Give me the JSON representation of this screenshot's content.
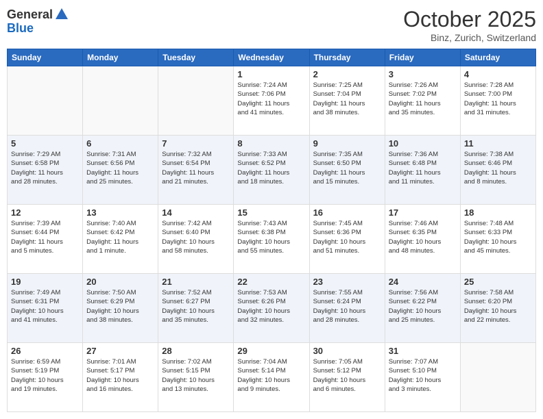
{
  "logo": {
    "general": "General",
    "blue": "Blue"
  },
  "title": "October 2025",
  "location": "Binz, Zurich, Switzerland",
  "days_of_week": [
    "Sunday",
    "Monday",
    "Tuesday",
    "Wednesday",
    "Thursday",
    "Friday",
    "Saturday"
  ],
  "weeks": [
    [
      {
        "day": "",
        "info": ""
      },
      {
        "day": "",
        "info": ""
      },
      {
        "day": "",
        "info": ""
      },
      {
        "day": "1",
        "info": "Sunrise: 7:24 AM\nSunset: 7:06 PM\nDaylight: 11 hours\nand 41 minutes."
      },
      {
        "day": "2",
        "info": "Sunrise: 7:25 AM\nSunset: 7:04 PM\nDaylight: 11 hours\nand 38 minutes."
      },
      {
        "day": "3",
        "info": "Sunrise: 7:26 AM\nSunset: 7:02 PM\nDaylight: 11 hours\nand 35 minutes."
      },
      {
        "day": "4",
        "info": "Sunrise: 7:28 AM\nSunset: 7:00 PM\nDaylight: 11 hours\nand 31 minutes."
      }
    ],
    [
      {
        "day": "5",
        "info": "Sunrise: 7:29 AM\nSunset: 6:58 PM\nDaylight: 11 hours\nand 28 minutes."
      },
      {
        "day": "6",
        "info": "Sunrise: 7:31 AM\nSunset: 6:56 PM\nDaylight: 11 hours\nand 25 minutes."
      },
      {
        "day": "7",
        "info": "Sunrise: 7:32 AM\nSunset: 6:54 PM\nDaylight: 11 hours\nand 21 minutes."
      },
      {
        "day": "8",
        "info": "Sunrise: 7:33 AM\nSunset: 6:52 PM\nDaylight: 11 hours\nand 18 minutes."
      },
      {
        "day": "9",
        "info": "Sunrise: 7:35 AM\nSunset: 6:50 PM\nDaylight: 11 hours\nand 15 minutes."
      },
      {
        "day": "10",
        "info": "Sunrise: 7:36 AM\nSunset: 6:48 PM\nDaylight: 11 hours\nand 11 minutes."
      },
      {
        "day": "11",
        "info": "Sunrise: 7:38 AM\nSunset: 6:46 PM\nDaylight: 11 hours\nand 8 minutes."
      }
    ],
    [
      {
        "day": "12",
        "info": "Sunrise: 7:39 AM\nSunset: 6:44 PM\nDaylight: 11 hours\nand 5 minutes."
      },
      {
        "day": "13",
        "info": "Sunrise: 7:40 AM\nSunset: 6:42 PM\nDaylight: 11 hours\nand 1 minute."
      },
      {
        "day": "14",
        "info": "Sunrise: 7:42 AM\nSunset: 6:40 PM\nDaylight: 10 hours\nand 58 minutes."
      },
      {
        "day": "15",
        "info": "Sunrise: 7:43 AM\nSunset: 6:38 PM\nDaylight: 10 hours\nand 55 minutes."
      },
      {
        "day": "16",
        "info": "Sunrise: 7:45 AM\nSunset: 6:36 PM\nDaylight: 10 hours\nand 51 minutes."
      },
      {
        "day": "17",
        "info": "Sunrise: 7:46 AM\nSunset: 6:35 PM\nDaylight: 10 hours\nand 48 minutes."
      },
      {
        "day": "18",
        "info": "Sunrise: 7:48 AM\nSunset: 6:33 PM\nDaylight: 10 hours\nand 45 minutes."
      }
    ],
    [
      {
        "day": "19",
        "info": "Sunrise: 7:49 AM\nSunset: 6:31 PM\nDaylight: 10 hours\nand 41 minutes."
      },
      {
        "day": "20",
        "info": "Sunrise: 7:50 AM\nSunset: 6:29 PM\nDaylight: 10 hours\nand 38 minutes."
      },
      {
        "day": "21",
        "info": "Sunrise: 7:52 AM\nSunset: 6:27 PM\nDaylight: 10 hours\nand 35 minutes."
      },
      {
        "day": "22",
        "info": "Sunrise: 7:53 AM\nSunset: 6:26 PM\nDaylight: 10 hours\nand 32 minutes."
      },
      {
        "day": "23",
        "info": "Sunrise: 7:55 AM\nSunset: 6:24 PM\nDaylight: 10 hours\nand 28 minutes."
      },
      {
        "day": "24",
        "info": "Sunrise: 7:56 AM\nSunset: 6:22 PM\nDaylight: 10 hours\nand 25 minutes."
      },
      {
        "day": "25",
        "info": "Sunrise: 7:58 AM\nSunset: 6:20 PM\nDaylight: 10 hours\nand 22 minutes."
      }
    ],
    [
      {
        "day": "26",
        "info": "Sunrise: 6:59 AM\nSunset: 5:19 PM\nDaylight: 10 hours\nand 19 minutes."
      },
      {
        "day": "27",
        "info": "Sunrise: 7:01 AM\nSunset: 5:17 PM\nDaylight: 10 hours\nand 16 minutes."
      },
      {
        "day": "28",
        "info": "Sunrise: 7:02 AM\nSunset: 5:15 PM\nDaylight: 10 hours\nand 13 minutes."
      },
      {
        "day": "29",
        "info": "Sunrise: 7:04 AM\nSunset: 5:14 PM\nDaylight: 10 hours\nand 9 minutes."
      },
      {
        "day": "30",
        "info": "Sunrise: 7:05 AM\nSunset: 5:12 PM\nDaylight: 10 hours\nand 6 minutes."
      },
      {
        "day": "31",
        "info": "Sunrise: 7:07 AM\nSunset: 5:10 PM\nDaylight: 10 hours\nand 3 minutes."
      },
      {
        "day": "",
        "info": ""
      }
    ]
  ]
}
